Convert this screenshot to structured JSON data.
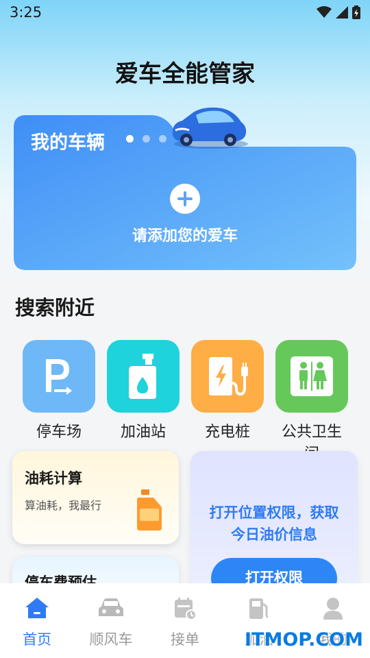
{
  "status_bar": {
    "time": "3:25"
  },
  "app_title": "爱车全能管家",
  "vehicle_card": {
    "title": "我的车辆",
    "add_label": "请添加您的爱车",
    "carousel_pages": 3,
    "active_page": 1
  },
  "nearby": {
    "title": "搜索附近",
    "items": [
      {
        "label": "停车场",
        "icon": "parking-icon",
        "color": "#6fb8f7"
      },
      {
        "label": "加油站",
        "icon": "fuel-can-icon",
        "color": "#1ed3db"
      },
      {
        "label": "充电桩",
        "icon": "charging-station-icon",
        "color": "#ffad45"
      },
      {
        "label": "公共卫生间",
        "icon": "restroom-icon",
        "color": "#66c85a"
      }
    ]
  },
  "fuel_card": {
    "title": "油耗计算",
    "subtitle": "算油耗，我最行",
    "icon": "oil-bottle-icon"
  },
  "parking_card": {
    "title": "停车费预估"
  },
  "permission_card": {
    "line1": "打开位置权限，获取",
    "line2": "今日油价信息",
    "button": "打开权限"
  },
  "tab_bar": [
    {
      "label": "首页",
      "icon": "home-icon",
      "active": true
    },
    {
      "label": "顺风车",
      "icon": "car-icon",
      "active": false
    },
    {
      "label": "接单",
      "icon": "calendar-clock-icon",
      "active": false
    },
    {
      "label": "加油",
      "icon": "gas-pump-icon",
      "active": false
    },
    {
      "label": "我的",
      "icon": "user-icon",
      "active": false
    }
  ],
  "watermark": "ITMOP.COM",
  "colors": {
    "accent": "#2f7bf5",
    "card_blue": "#4f9df6"
  }
}
